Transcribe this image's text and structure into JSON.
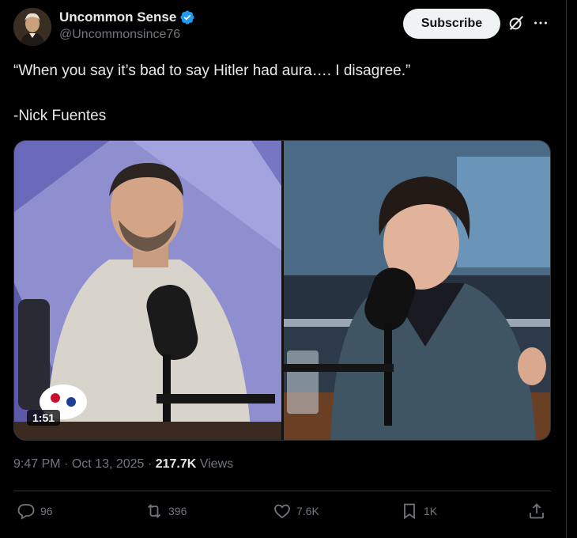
{
  "author": {
    "display_name": "Uncommon Sense",
    "handle": "@Uncommonsince76",
    "verified": true,
    "verified_color": "#1d9bf0"
  },
  "header": {
    "subscribe_label": "Subscribe",
    "grok_icon": "grok-slash-icon",
    "more_icon": "more-dots-icon"
  },
  "post": {
    "quote": "“When you say it’s bad to say Hitler had aura…. I disagree.”",
    "attribution": "-Nick Fuentes"
  },
  "media": {
    "type": "video",
    "duration": "1:51"
  },
  "meta": {
    "time": "9:47 PM",
    "date": "Oct 13, 2025",
    "separator": "·",
    "views_count": "217.7K",
    "views_label": "Views"
  },
  "actions": {
    "replies": "96",
    "reposts": "396",
    "likes": "7.6K",
    "bookmarks": "1K"
  },
  "colors": {
    "background": "#000000",
    "text_primary": "#e7e9ea",
    "text_secondary": "#71767b",
    "border": "#2f3336"
  }
}
